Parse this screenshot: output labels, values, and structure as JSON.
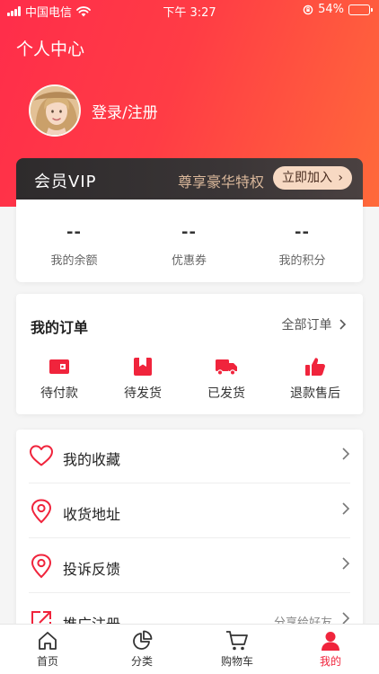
{
  "status_bar": {
    "carrier": "中国电信",
    "time": "下午 3:27",
    "battery": "54%",
    "battery_level": 0.54
  },
  "header": {
    "title": "个人中心",
    "login_text": "登录/注册"
  },
  "vip": {
    "title": "会员VIP",
    "subtitle": "尊享豪华特权",
    "button": "立即加入",
    "button_chevron": "›"
  },
  "assets": [
    {
      "value": "--",
      "label": "我的余额"
    },
    {
      "value": "--",
      "label": "优惠券"
    },
    {
      "value": "--",
      "label": "我的积分"
    }
  ],
  "orders": {
    "title": "我的订单",
    "all_label": "全部订单",
    "items": [
      {
        "label": "待付款",
        "icon": "wallet-icon"
      },
      {
        "label": "待发货",
        "icon": "box-icon"
      },
      {
        "label": "已发货",
        "icon": "truck-icon"
      },
      {
        "label": "退款售后",
        "icon": "thumbs-up-icon"
      }
    ]
  },
  "menu": [
    {
      "label": "我的收藏",
      "icon": "heart-icon",
      "extra": ""
    },
    {
      "label": "收货地址",
      "icon": "location-pin-icon",
      "extra": ""
    },
    {
      "label": "投诉反馈",
      "icon": "location-pin-icon",
      "extra": ""
    },
    {
      "label": "推广注册",
      "icon": "share-icon",
      "extra": "分享给好友"
    }
  ],
  "tabbar": [
    {
      "label": "首页",
      "icon": "home-icon"
    },
    {
      "label": "分类",
      "icon": "pie-chart-icon"
    },
    {
      "label": "购物车",
      "icon": "cart-icon"
    },
    {
      "label": "我的",
      "icon": "user-icon",
      "active": true
    }
  ],
  "colors": {
    "accent": "#f0243c",
    "hero_start": "#ff2d4a",
    "hero_end": "#ff6a3a",
    "vip_bg": "#2e2b2c",
    "vip_gold": "#d9b79a"
  }
}
